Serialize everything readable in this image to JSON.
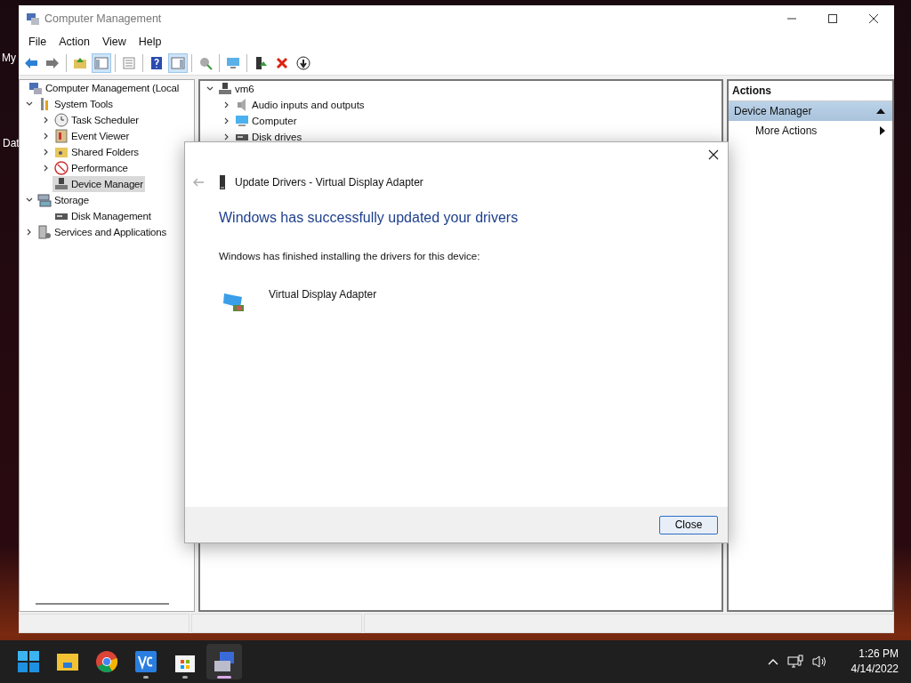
{
  "desktop": {
    "icons": [
      {
        "label": "My"
      },
      {
        "label": "Dat"
      }
    ]
  },
  "window": {
    "title": "Computer Management"
  },
  "menu": [
    {
      "label": "File"
    },
    {
      "label": "Action"
    },
    {
      "label": "View"
    },
    {
      "label": "Help"
    }
  ],
  "toolbar": [
    {
      "kind": "back",
      "pressed": false
    },
    {
      "kind": "forward",
      "pressed": false
    },
    {
      "kind": "sep"
    },
    {
      "kind": "up",
      "pressed": false
    },
    {
      "kind": "tree",
      "pressed": true
    },
    {
      "kind": "sep"
    },
    {
      "kind": "list",
      "pressed": false
    },
    {
      "kind": "sep"
    },
    {
      "kind": "help",
      "pressed": false
    },
    {
      "kind": "pane",
      "pressed": true
    },
    {
      "kind": "sep"
    },
    {
      "kind": "scan",
      "pressed": false
    },
    {
      "kind": "sep"
    },
    {
      "kind": "monitor",
      "pressed": false
    },
    {
      "kind": "sep"
    },
    {
      "kind": "update",
      "pressed": false
    },
    {
      "kind": "remove",
      "pressed": false
    },
    {
      "kind": "download",
      "pressed": false
    }
  ],
  "tree": [
    {
      "label": "Computer Management (Local",
      "selected": false,
      "children": [
        {
          "label": "System Tools",
          "expanded": true,
          "selected": false,
          "children": [
            {
              "label": "Task Scheduler",
              "expanded": false,
              "selected": false
            },
            {
              "label": "Event Viewer",
              "expanded": false,
              "selected": false
            },
            {
              "label": "Shared Folders",
              "expanded": false,
              "selected": false
            },
            {
              "label": "Performance",
              "expanded": false,
              "selected": false
            },
            {
              "label": "Device Manager",
              "selected": true
            }
          ]
        },
        {
          "label": "Storage",
          "expanded": true,
          "selected": false,
          "children": [
            {
              "label": "Disk Management",
              "selected": false
            }
          ]
        },
        {
          "label": "Services and Applications",
          "expanded": false,
          "selected": false
        }
      ]
    }
  ],
  "devices": [
    {
      "label": "vm6",
      "expanded": true,
      "children": [
        {
          "label": "Audio inputs and outputs",
          "expanded": false
        },
        {
          "label": "Computer",
          "expanded": false
        },
        {
          "label": "Disk drives",
          "expanded": false
        }
      ]
    }
  ],
  "actions": {
    "header": "Actions",
    "section": {
      "label": "Device Manager",
      "expanded": true
    },
    "items": [
      {
        "label": "More Actions"
      }
    ]
  },
  "dialog": {
    "title": "Update Drivers - Virtual Display Adapter",
    "heading": "Windows has successfully updated your drivers",
    "message": "Windows has finished installing the drivers for this device:",
    "device": "Virtual Display Adapter",
    "button": "Close"
  },
  "taskbar": {
    "apps": [
      {
        "kind": "start",
        "running": false,
        "active": false
      },
      {
        "kind": "explorer",
        "running": false,
        "active": false
      },
      {
        "kind": "chrome",
        "running": false,
        "active": false
      },
      {
        "kind": "editor",
        "running": true,
        "active": false
      },
      {
        "kind": "store",
        "running": true,
        "active": false
      },
      {
        "kind": "manage",
        "running": true,
        "active": true
      }
    ],
    "time": "1:26 PM",
    "date": "4/14/2022"
  }
}
